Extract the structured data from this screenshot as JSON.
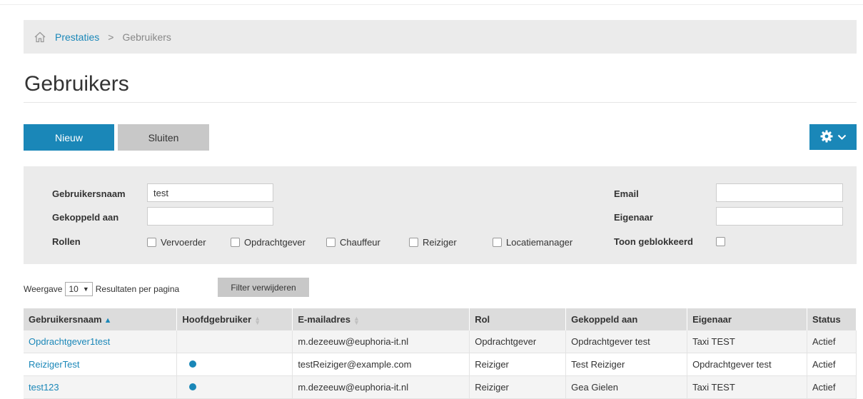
{
  "breadcrumb": {
    "link": "Prestaties",
    "separator": ">",
    "current": "Gebruikers"
  },
  "page_title": "Gebruikers",
  "toolbar": {
    "new_label": "Nieuw",
    "close_label": "Sluiten"
  },
  "filters": {
    "username_label": "Gebruikersnaam",
    "username_value": "test",
    "linked_label": "Gekoppeld aan",
    "linked_value": "",
    "roles_label": "Rollen",
    "roles": [
      "Vervoerder",
      "Opdrachtgever",
      "Chauffeur",
      "Reiziger",
      "Locatiemanager"
    ],
    "email_label": "Email",
    "email_value": "",
    "owner_label": "Eigenaar",
    "owner_value": "",
    "blocked_label": "Toon geblokkeerd"
  },
  "paging": {
    "prefix": "Weergave",
    "page_size": "10",
    "suffix": "Resultaten per pagina",
    "remove_filter_label": "Filter verwijderen"
  },
  "table": {
    "columns": [
      "Gebruikersnaam",
      "Hoofdgebruiker",
      "E-mailadres",
      "Rol",
      "Gekoppeld aan",
      "Eigenaar",
      "Status"
    ],
    "rows": [
      {
        "username": "Opdrachtgever1test",
        "main_user": false,
        "email": "m.dezeeuw@euphoria-it.nl",
        "role": "Opdrachtgever",
        "linked": "Opdrachtgever test",
        "owner": "Taxi TEST",
        "status": "Actief"
      },
      {
        "username": "ReizigerTest",
        "main_user": true,
        "email": "testReiziger@example.com",
        "role": "Reiziger",
        "linked": "Test Reiziger",
        "owner": "Opdrachtgever test",
        "status": "Actief"
      },
      {
        "username": "test123",
        "main_user": true,
        "email": "m.dezeeuw@euphoria-it.nl",
        "role": "Reiziger",
        "linked": "Gea Gielen",
        "owner": "Taxi TEST",
        "status": "Actief"
      }
    ]
  },
  "colors": {
    "accent": "#1a87b8",
    "panel": "#ebebeb",
    "header": "#dcdcdc",
    "secondary_button": "#c8c8c8"
  },
  "icons": {
    "home": "home-icon",
    "settings": "gear-icon",
    "dropdown": "chevron-down-icon"
  }
}
